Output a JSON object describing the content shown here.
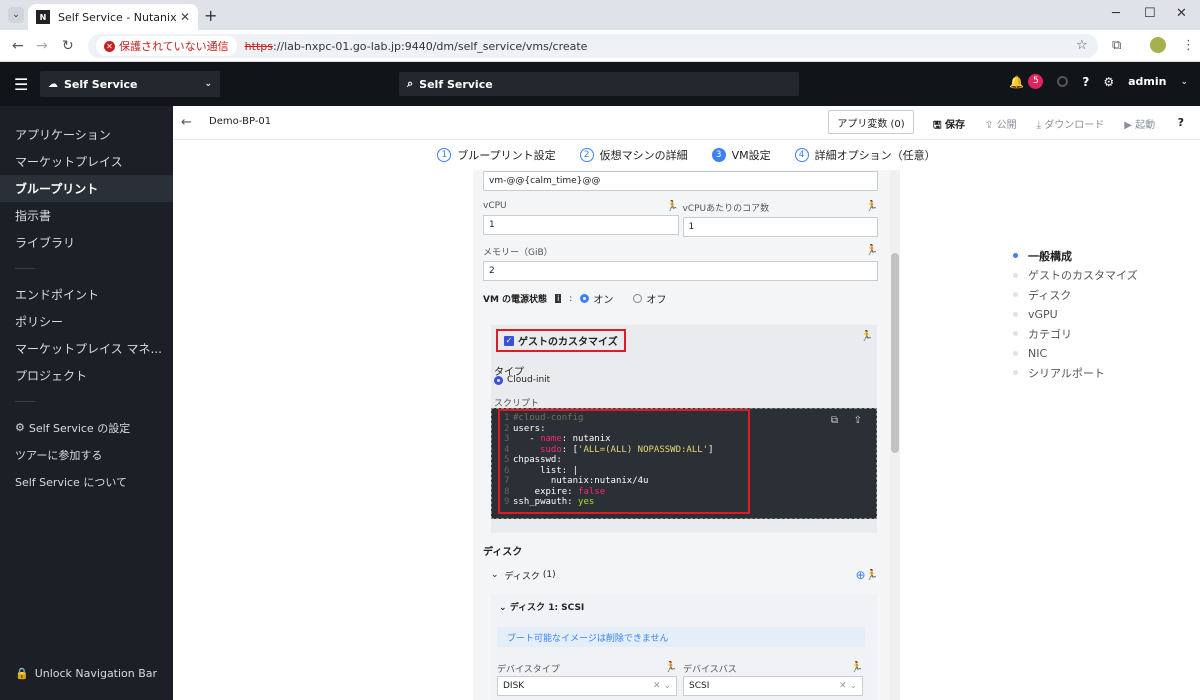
{
  "browser": {
    "tab_title": "Self Service - Nutanix",
    "security_warning": "保護されていない通信",
    "url_scheme": "https",
    "url_rest": "://lab-nxpc-01.go-lab.jp:9440/dm/self_service/vms/create"
  },
  "header": {
    "app_name": "Self Service",
    "search_text": "Self Service",
    "notif_count": "5",
    "user": "admin"
  },
  "sidebar": {
    "items": [
      "アプリケーション",
      "マーケットプレイス",
      "ブループリント",
      "指示書",
      "ライブラリ"
    ],
    "items2": [
      "エンドポイント",
      "ポリシー",
      "マーケットプレイス マネ...",
      "プロジェクト"
    ],
    "items3": [
      "Self Service の設定",
      "ツアーに参加する",
      "Self Service について"
    ],
    "unlock": "Unlock Navigation Bar"
  },
  "toolbar": {
    "blueprint_name": "Demo-BP-01",
    "app_var_label": "アプリ変数 (0)",
    "save": "保存",
    "publish": "公開",
    "download": "ダウンロード",
    "launch": "起動",
    "help": "?"
  },
  "steps": [
    {
      "num": "1",
      "label": "ブループリント設定"
    },
    {
      "num": "2",
      "label": "仮想マシンの詳細"
    },
    {
      "num": "3",
      "label": "VM設定"
    },
    {
      "num": "4",
      "label": "詳細オプション（任意）"
    }
  ],
  "form": {
    "vm_name_value": "vm-@@{calm_time}@@",
    "vcpu_label": "vCPU",
    "vcpu_value": "1",
    "cores_label": "vCPUあたりのコア数",
    "cores_value": "1",
    "memory_label": "メモリー（GiB）",
    "memory_value": "2",
    "power_label": "VM の電源状態",
    "power_on": "オン",
    "power_off": "オフ"
  },
  "guest": {
    "title": "ゲストのカスタマイズ",
    "type_label": "タイプ",
    "type_value": "Cloud-init",
    "script_label": "スクリプト",
    "code_lines": [
      "#cloud-config",
      "users:",
      "  - name: nutanix",
      "    sudo: ['ALL=(ALL) NOPASSWD:ALL']",
      "chpasswd:",
      "    list: |",
      "      nutanix:nutanix/4u",
      "    expire: false",
      "ssh_pwauth: yes"
    ]
  },
  "disk": {
    "section_title": "ディスク",
    "group_label": "ディスク",
    "group_count": "(1)",
    "disk1_title": "ディスク 1: SCSI",
    "info": "ブート可能なイメージは削除できません",
    "device_type_label": "デバイスタイプ",
    "device_type_value": "DISK",
    "device_bus_label": "デバイスバス",
    "device_bus_value": "SCSI"
  },
  "toc": [
    "一般構成",
    "ゲストのカスタマイズ",
    "ディスク",
    "vGPU",
    "カテゴリ",
    "NIC",
    "シリアルポート"
  ]
}
